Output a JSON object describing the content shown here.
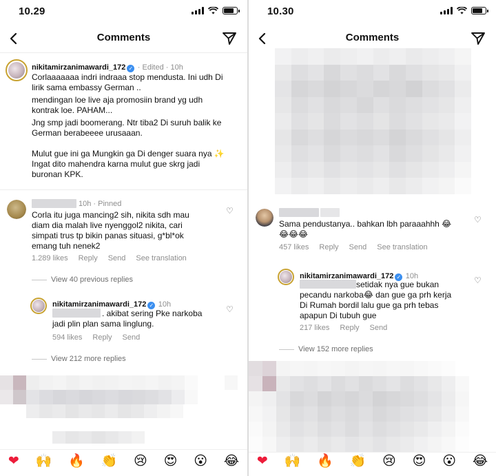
{
  "left": {
    "status_time": "10.29",
    "title": "Comments",
    "caption": {
      "username": "nikitamirzanimawardi_172",
      "meta": "· Edited · 10h",
      "lines": [
        "Corlaaaaaaa indri indraaa stop mendusta. Ini udh Di",
        "lirik sama embassy German ..",
        "mendingan loe live aja promosiin brand yg udh",
        "kontrak loe. PAHAM...",
        "Jng smp jadi boomerang. Ntr tiba2 Di suruh balik ke",
        "German berabeeee urusaaan.",
        "",
        "Mulut gue ini ga Mungkin ga Di denger suara nya ✨",
        "Ingat dito mahendra karna mulut gue skrg jadi",
        "buronan KPK."
      ]
    },
    "comment": {
      "meta": "10h · Pinned",
      "lines": [
        "Corla itu juga mancing2 sih, nikita sdh mau",
        "diam dia malah live nyenggol2 nikita, cari",
        "simpati trus tp bikin panas situasi, g*bl*ok",
        "emang tuh nenek2"
      ],
      "likes": "1.289 likes",
      "reply": "Reply",
      "send": "Send",
      "translate": "See translation"
    },
    "view_previous": "View 40 previous replies",
    "reply": {
      "username": "nikitamirzanimawardi_172",
      "meta": "10h",
      "lines": [
        ". akibat sering Pke narkoba",
        "jadi plin plan sama linglung."
      ],
      "likes": "594 likes",
      "reply": "Reply",
      "send": "Send"
    },
    "view_more": "View 212 more replies"
  },
  "right": {
    "status_time": "10.30",
    "title": "Comments",
    "comment": {
      "lines": [
        "Sama pendustanya.. bahkan lbh paraaahhh 😂",
        "😂😂😂"
      ],
      "likes": "457 likes",
      "reply": "Reply",
      "send": "Send",
      "translate": "See translation"
    },
    "reply": {
      "username": "nikitamirzanimawardi_172",
      "meta": "10h",
      "lines": [
        " setidak nya gue bukan",
        "pecandu narkoba😂 dan gue ga prh kerja",
        "Di Rumah  bordil lalu gue ga prh tebas",
        "apapun Di tubuh gue"
      ],
      "likes": "217 likes",
      "reply": "Reply",
      "send": "Send"
    },
    "view_more": "View 152 more replies"
  },
  "emoji_bar": [
    "❤",
    "🙌",
    "🔥",
    "👏",
    "😢",
    "😍",
    "😮",
    "😂"
  ],
  "colors": {
    "verified_blue": "#3b8ff0",
    "heart_red": "#ed1c3a",
    "meta_gray": "#8e8e8e"
  }
}
